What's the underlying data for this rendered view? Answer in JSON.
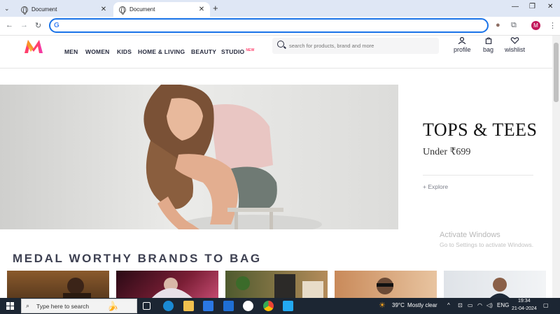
{
  "browser": {
    "tabs": [
      {
        "title": "Document",
        "close": "✕"
      },
      {
        "title": "Document",
        "close": "✕"
      }
    ],
    "new_tab": "+",
    "omnibox_value": "",
    "profile_initial": "M"
  },
  "site": {
    "nav": [
      {
        "label": "MEN"
      },
      {
        "label": "WOMEN"
      },
      {
        "label": "KIDS"
      },
      {
        "label": "HOME & LIVING"
      },
      {
        "label": "BEAUTY"
      },
      {
        "label": "STUDIO",
        "badge": "NEW"
      }
    ],
    "search_placeholder": "search for products, brand and more",
    "header_actions": [
      {
        "label": "profile"
      },
      {
        "label": "bag"
      },
      {
        "label": "wishlist"
      }
    ],
    "hero": {
      "title": "TOPS & TEES",
      "subtitle": "Under ₹699",
      "cta": "+ Explore"
    },
    "section_title": "MEDAL WORTHY BRANDS TO BAG"
  },
  "watermark": {
    "line1": "Activate Windows",
    "line2": "Go to Settings to activate Windows."
  },
  "taskbar": {
    "search_placeholder": "Type here to search",
    "weather_temp": "39°C",
    "weather_text": "Mostly clear",
    "lang": "ENG",
    "time": "19:34",
    "date": "21-04-2024"
  },
  "colors": {
    "brand_pink": "#ff3f6c",
    "accent_blue": "#1a73e8",
    "text_dark": "#282c3f"
  }
}
